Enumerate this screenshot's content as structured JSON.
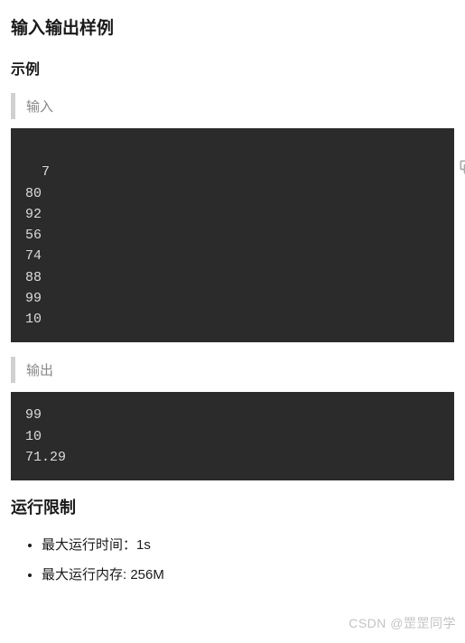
{
  "section": {
    "title": "输入输出样例",
    "example_label": "示例",
    "input_label": "输入",
    "output_label": "输出"
  },
  "sample": {
    "input": "7\n80\n92\n56\n74\n88\n99\n10",
    "output": "99\n10\n71.29"
  },
  "limits": {
    "title": "运行限制",
    "items": [
      "最大运行时间：1s",
      "最大运行内存: 256M"
    ]
  },
  "watermark": "CSDN @罡罡同学"
}
